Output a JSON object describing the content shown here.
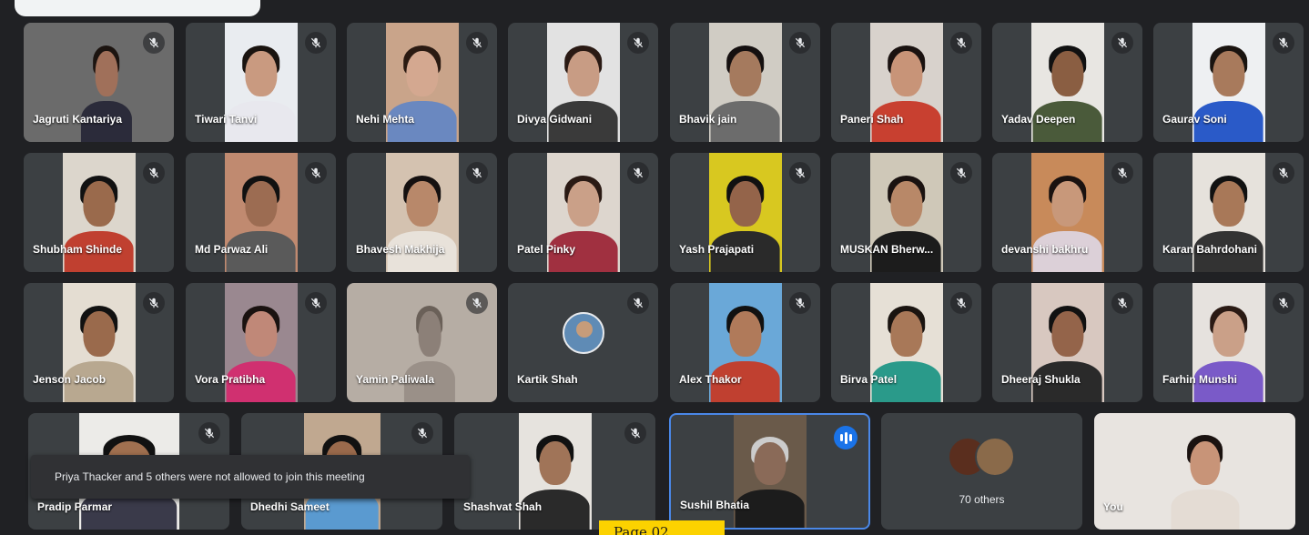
{
  "notification": {
    "text": "Priya Thacker and 5 others were not allowed to join this meeting"
  },
  "page_label": "Page 02",
  "icons": {
    "mute": "mic-off-icon",
    "speaking": "audio-level-icon"
  },
  "colors": {
    "background": "#202124",
    "tile": "#3c4043",
    "speaking_border": "#4a88e8",
    "page_label_bg": "#fcd200"
  },
  "participants": [
    {
      "name": "Jagruti Kantariya"
    },
    {
      "name": "Tiwari Tanvi"
    },
    {
      "name": "Nehi Mehta"
    },
    {
      "name": "Divya Gidwani"
    },
    {
      "name": "Bhavik jain"
    },
    {
      "name": "Paneri Shah"
    },
    {
      "name": "Yadav Deepen"
    },
    {
      "name": "Gaurav Soni"
    },
    {
      "name": "Shubham Shinde"
    },
    {
      "name": "Md Parwaz Ali"
    },
    {
      "name": "Bhavesh Makhija"
    },
    {
      "name": "Patel Pinky"
    },
    {
      "name": "Yash Prajapati"
    },
    {
      "name": "MUSKAN Bherw..."
    },
    {
      "name": "devanshi bakhru"
    },
    {
      "name": "Karan Bahrdohani"
    },
    {
      "name": "Jenson Jacob"
    },
    {
      "name": "Vora Pratibha"
    },
    {
      "name": "Yamin Paliwala"
    },
    {
      "name": "Kartik Shah"
    },
    {
      "name": "Alex Thakor"
    },
    {
      "name": "Birva Patel"
    },
    {
      "name": "Dheeraj Shukla"
    },
    {
      "name": "Farhin Munshi"
    },
    {
      "name": "Pradip Parmar"
    },
    {
      "name": "Dhedhi Sameet"
    },
    {
      "name": "Shashvat Shah"
    },
    {
      "name": "Sushil Bhatia"
    },
    {
      "name": "70 others"
    },
    {
      "name": "You"
    }
  ]
}
